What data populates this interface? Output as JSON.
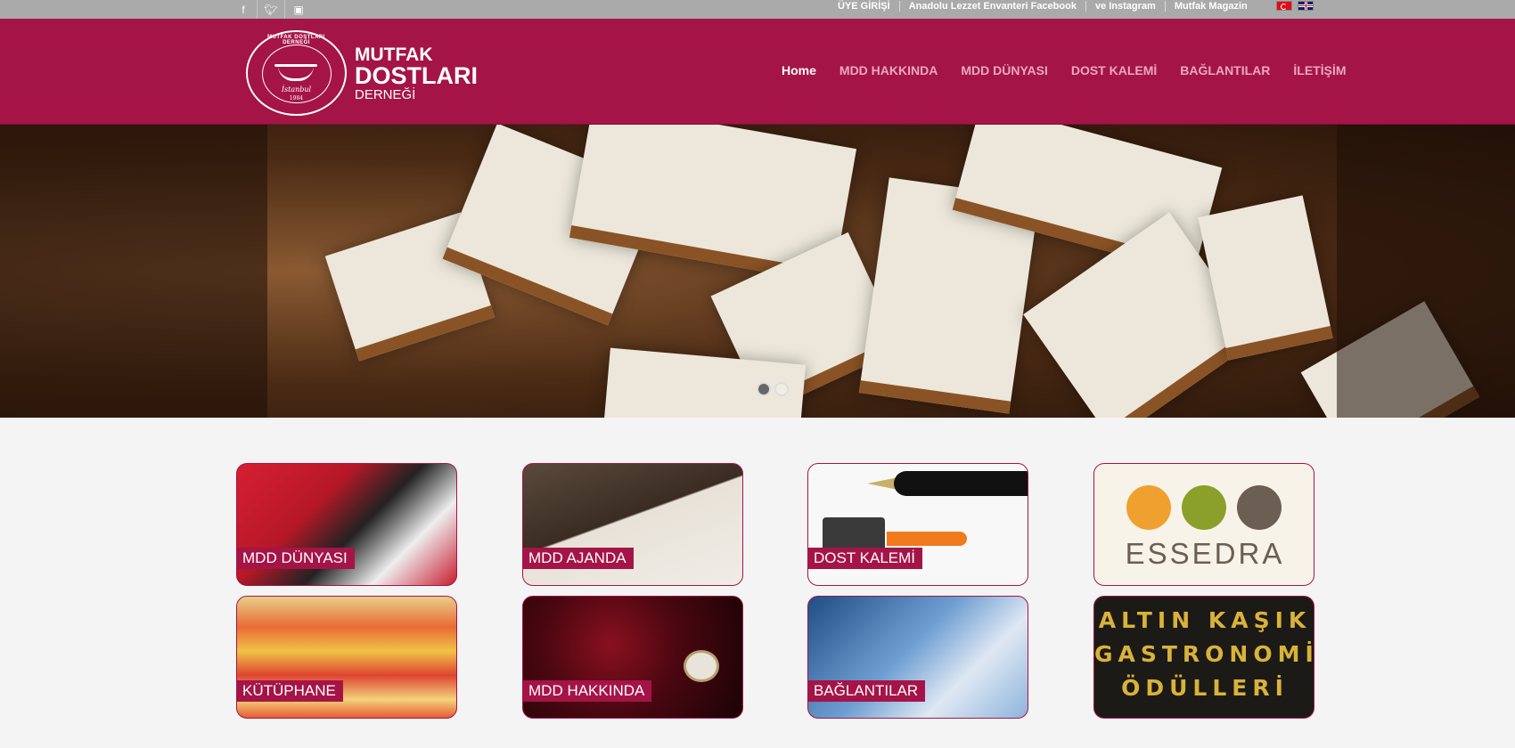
{
  "top_links": [
    "ÜYE GİRİŞİ",
    "Anadolu Lezzet Envanteri Facebook",
    "ve Instagram",
    "Mutfak Magazin"
  ],
  "social_icons": [
    "facebook-icon",
    "twitter-icon",
    "instagram-icon"
  ],
  "flags": [
    "turkish-flag-icon",
    "uk-flag-icon"
  ],
  "logo": {
    "line1": "MUTFAK",
    "line2": "DOSTLARI",
    "line3": "DERNEĞİ",
    "emblem_script": "İstanbul",
    "emblem_year": "1984",
    "emblem_arc": "MUTFAK DOSTLARI DERNEĞİ"
  },
  "nav": [
    {
      "label": "Home",
      "active": true
    },
    {
      "label": "MDD HAKKINDA"
    },
    {
      "label": "MDD DÜNYASI"
    },
    {
      "label": "DOST KALEMİ"
    },
    {
      "label": "BAĞLANTILAR"
    },
    {
      "label": "İLETİŞİM"
    }
  ],
  "slider": {
    "slide_count": 2,
    "active_slide": 1
  },
  "tiles": [
    {
      "label": "MDD DÜNYASI"
    },
    {
      "label": "MDD AJANDA"
    },
    {
      "label": "DOST KALEMİ"
    },
    {
      "label": "ESSEDRA"
    },
    {
      "label": "KÜTÜPHANE"
    },
    {
      "label": "MDD HAKKINDA"
    },
    {
      "label": "BAĞLANTILAR"
    },
    {
      "label": "ALTIN KAŞIK GASTRONOMİ ÖDÜLLERİ",
      "lines": [
        "ALTIN KAŞIK",
        "GASTRONOMİ",
        "ÖDÜLLERİ"
      ]
    }
  ],
  "colors": {
    "brand": "#a51447",
    "topbar": "#aaaaaa",
    "background": "#f4f4f4"
  }
}
